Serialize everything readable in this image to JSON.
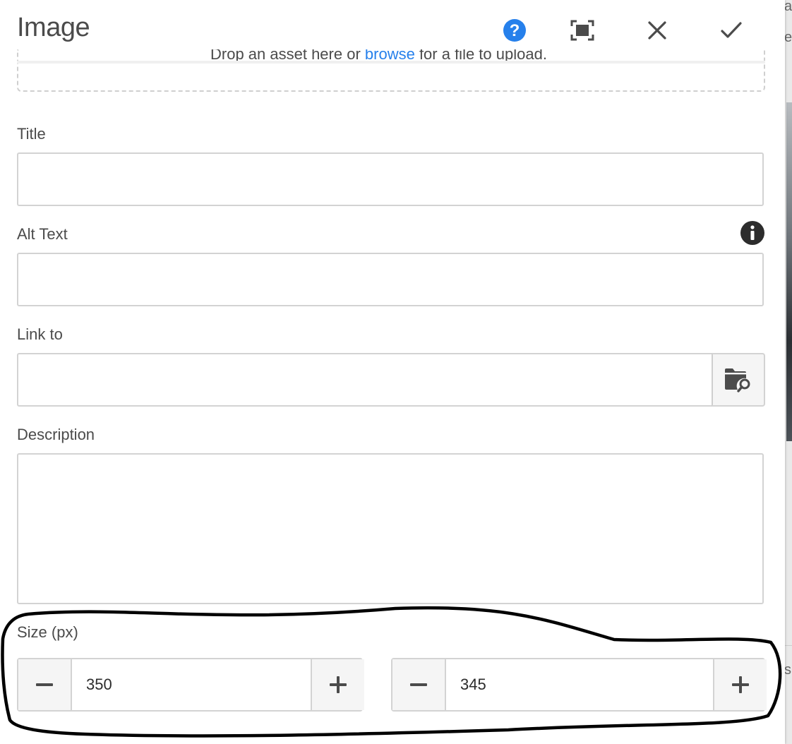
{
  "dialog": {
    "title": "Image",
    "header_actions": [
      {
        "name": "help-icon",
        "color": "#2680eb"
      },
      {
        "name": "fullscreen-icon"
      },
      {
        "name": "close-icon"
      },
      {
        "name": "check-icon"
      }
    ]
  },
  "dropzone": {
    "text_before": "Drop an asset here or ",
    "browse_label": "browse",
    "text_after": " for a file to upload."
  },
  "fields": {
    "title": {
      "label": "Title",
      "value": ""
    },
    "alt_text": {
      "label": "Alt Text",
      "value": "",
      "info_icon": "info-icon"
    },
    "link_to": {
      "label": "Link to",
      "value": "",
      "picker_icon": "folder-search-icon"
    },
    "description": {
      "label": "Description",
      "value": ""
    }
  },
  "size": {
    "label": "Size (px)",
    "width": "350",
    "height": "345"
  },
  "colors": {
    "accent": "#2680eb",
    "text": "#4b4b4b",
    "border": "#d3d3d3",
    "annotation": "#000000"
  }
}
